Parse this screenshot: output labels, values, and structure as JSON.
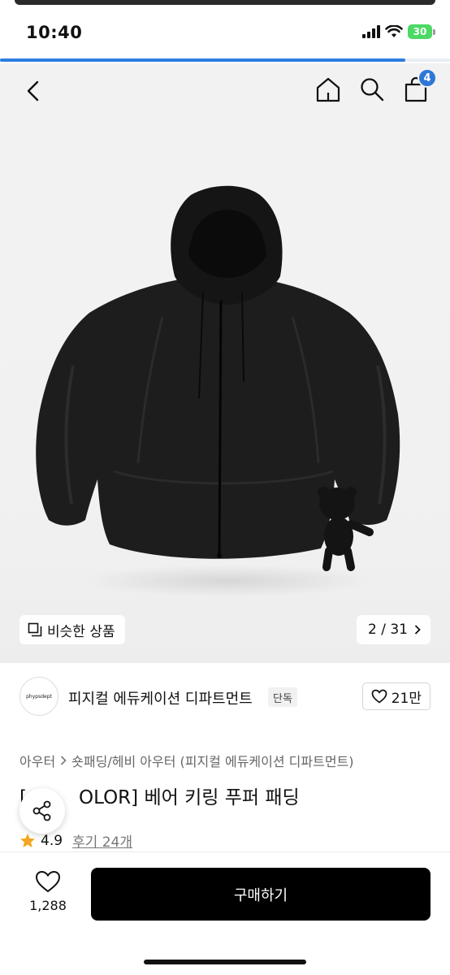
{
  "status": {
    "time": "10:40",
    "battery": "30"
  },
  "progress": {
    "fraction": 0.9
  },
  "nav": {
    "cart_count": "4"
  },
  "gallery": {
    "similar_label": "비슷한 상품",
    "page_indicator": "2 / 31"
  },
  "brand": {
    "logo_text": "phypsdept",
    "name": "피지컬 에듀케이션 디파트먼트",
    "tag": "단독",
    "likes": "21만"
  },
  "product": {
    "breadcrumb": [
      "아우터",
      "숏패딩/헤비 아우터 (피지컬 에듀케이션 디파트먼트)"
    ],
    "title_prefix": "[",
    "title_suffix": "OLOR] 베어 키링 푸퍼 패딩",
    "rating": "4.9",
    "reviews": "후기 24개"
  },
  "bottom": {
    "wish_count": "1,288",
    "buy_label": "구매하기"
  },
  "colors": {
    "accent": "#2d7de0",
    "badge": "#2e77d7",
    "star": "#f5a623",
    "buy": "#000000"
  }
}
